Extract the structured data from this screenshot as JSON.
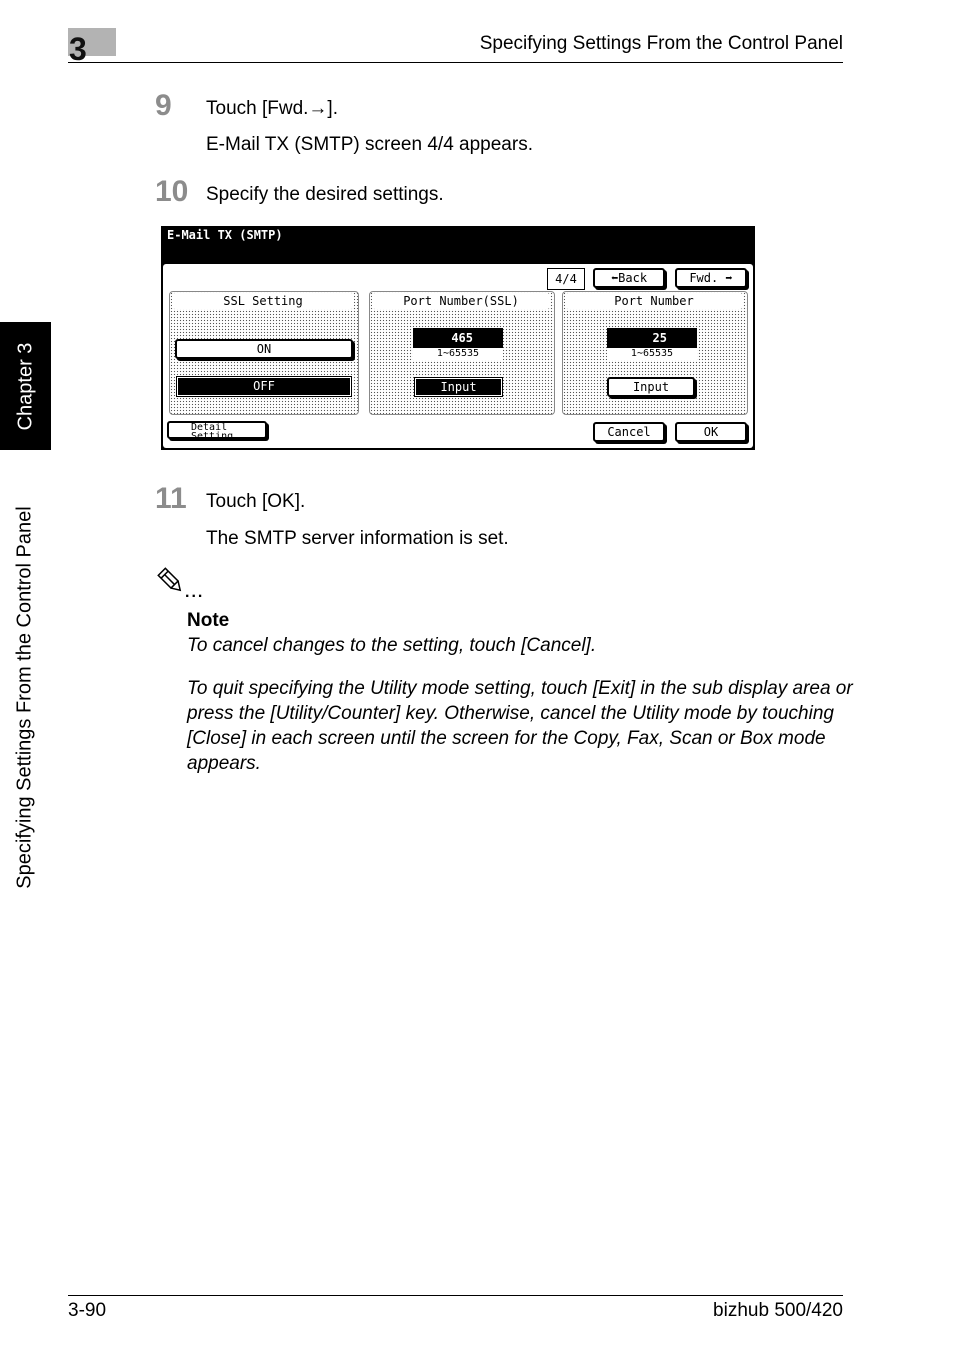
{
  "header": {
    "chapter_number": "3",
    "section_title": "Specifying Settings From the Control Panel"
  },
  "side_tab": {
    "chapter_label": "Chapter 3",
    "section_label": "Specifying Settings From the Control Panel"
  },
  "steps": [
    {
      "number": "9",
      "text": "Touch [Fwd.→].",
      "result": "E-Mail TX (SMTP) screen 4/4 appears."
    },
    {
      "number": "10",
      "text": "Specify the desired settings."
    },
    {
      "number": "11",
      "text": "Touch [OK].",
      "result": "The SMTP server information is set."
    }
  ],
  "panel": {
    "title": "E-Mail TX (SMTP)",
    "page_indicator": "4/4",
    "back_label": "⬅Back",
    "fwd_label": "Fwd. ➡",
    "ssl_setting": {
      "label": "SSL Setting",
      "on_label": "ON",
      "off_label": "OFF",
      "selected": "OFF"
    },
    "port_ssl": {
      "label": "Port Number(SSL)",
      "value": "465",
      "range": "1∼65535",
      "input_label": "Input"
    },
    "port": {
      "label": "Port Number",
      "value": "25",
      "range": "1∼65535",
      "input_label": "Input"
    },
    "detail_label_1": "Detail",
    "detail_label_2": "Setting",
    "cancel_label": "Cancel",
    "ok_label": "OK"
  },
  "note": {
    "icon": "pencil-icon",
    "dots": "...",
    "label": "Note",
    "paragraphs": [
      "To cancel changes to the setting, touch [Cancel].",
      "To quit specifying the Utility mode setting, touch [Exit] in the sub display area or press the [Utility/Counter] key. Otherwise, cancel the Utility mode by touching [Close] in each screen until the screen for the Copy, Fax, Scan or Box mode appears."
    ]
  },
  "footer": {
    "page_number": "3-90",
    "model": "bizhub 500/420"
  }
}
